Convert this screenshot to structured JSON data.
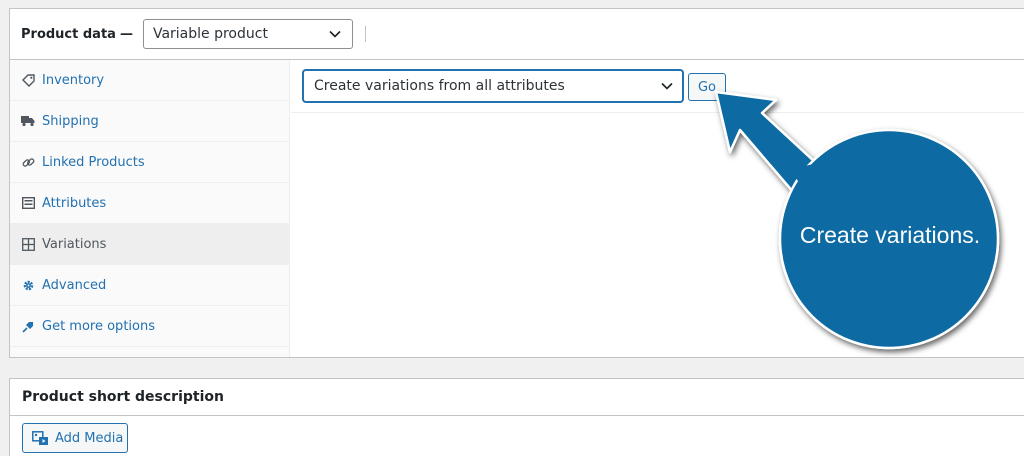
{
  "product_data": {
    "label": "Product data",
    "dash": "—",
    "type_select": "Variable product"
  },
  "tabs": [
    {
      "label": "Inventory",
      "icon": "tag-icon"
    },
    {
      "label": "Shipping",
      "icon": "truck-icon"
    },
    {
      "label": "Linked Products",
      "icon": "link-icon"
    },
    {
      "label": "Attributes",
      "icon": "list-icon"
    },
    {
      "label": "Variations",
      "icon": "grid-icon",
      "active": true
    },
    {
      "label": "Advanced",
      "icon": "gear-icon"
    },
    {
      "label": "Get more options",
      "icon": "plugin-icon"
    }
  ],
  "variations": {
    "action_select": "Create variations from all attributes",
    "go_label": "Go"
  },
  "short_description": {
    "title": "Product short description",
    "add_media": "Add Media"
  },
  "annotation": {
    "text": "Create variations.",
    "color": "#0e6aa3"
  },
  "colors": {
    "link": "#2271b1",
    "border": "#c3c4c7"
  }
}
